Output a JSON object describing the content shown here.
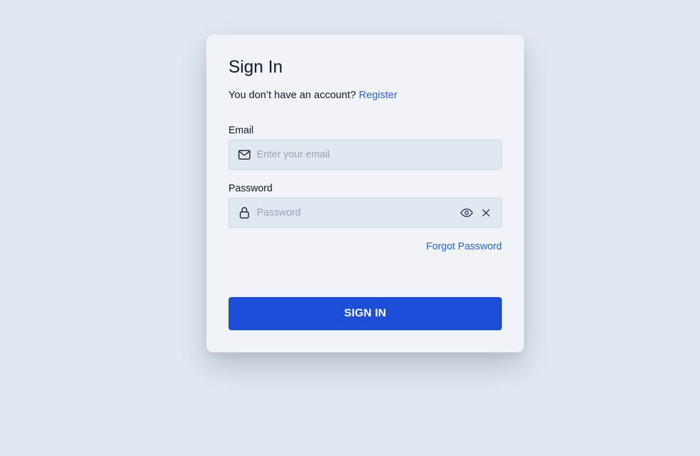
{
  "signin": {
    "title": "Sign In",
    "no_account_text": "You don’t have an account?",
    "register_link": "Register",
    "email": {
      "label": "Email",
      "placeholder": "Enter your email",
      "value": "",
      "icon": "mail-icon"
    },
    "password": {
      "label": "Password",
      "placeholder": "Password",
      "value": "",
      "icon": "lock-icon",
      "toggle_icon": "eye-icon",
      "clear_icon": "close-icon"
    },
    "forgot_password_link": "Forgot Password",
    "submit_label": "SIGN IN"
  },
  "colors": {
    "page_background": "#e2e8f0",
    "card_background": "#f0f4f9",
    "field_background": "#e2e8f0",
    "link": "#2563eb",
    "primary_button": "#1d4ed8",
    "button_text": "#ffffff"
  }
}
